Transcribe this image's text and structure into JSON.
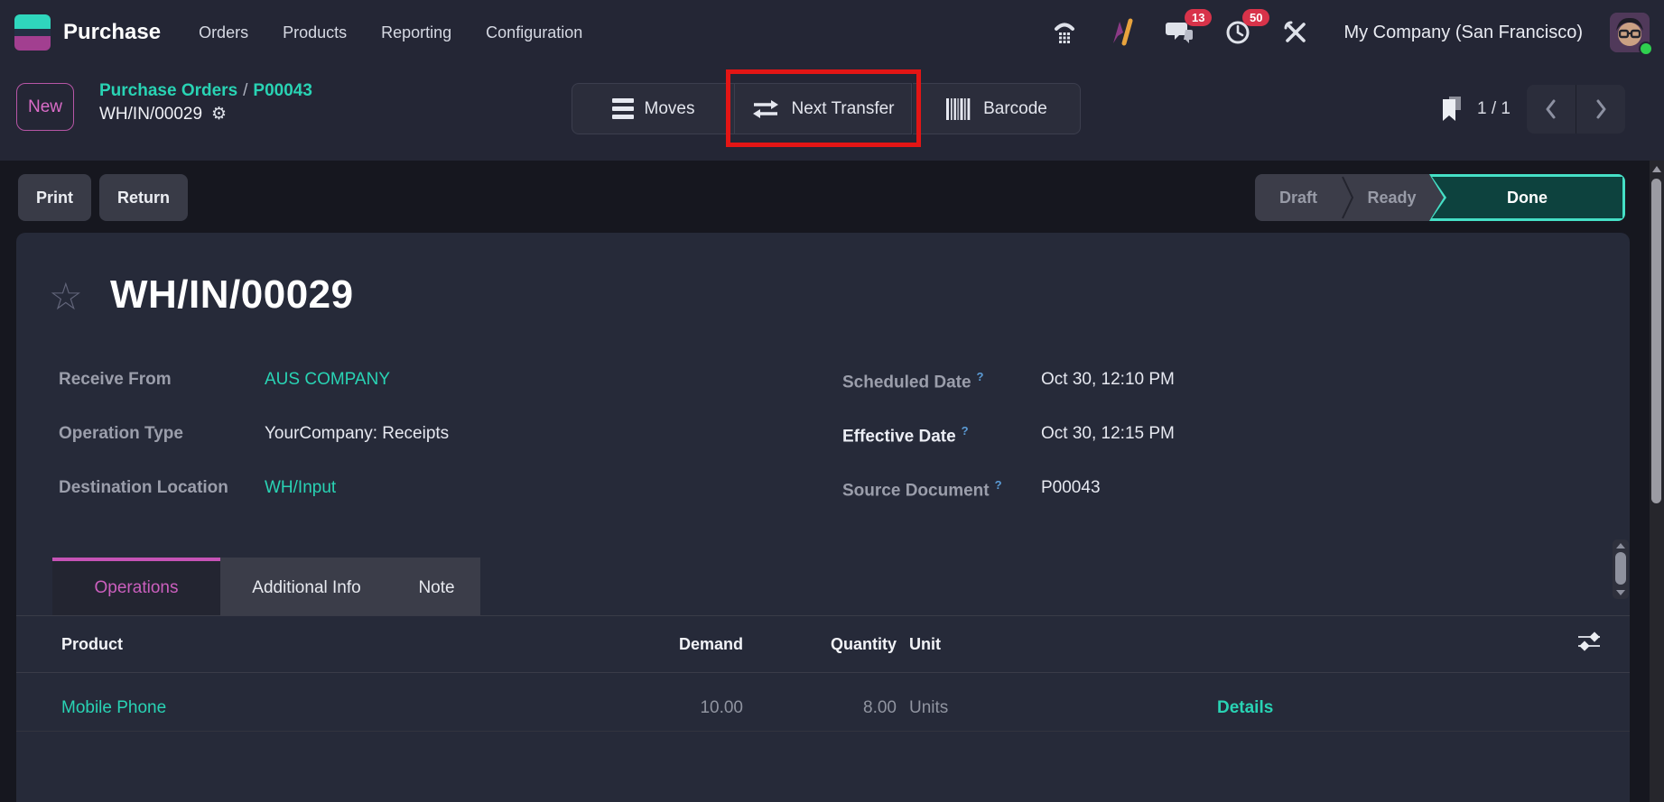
{
  "colors": {
    "accent_teal": "#29d3b4",
    "accent_pink": "#c653b6",
    "badge_red": "#d8334a",
    "annotation_red": "#e31515",
    "done_fill": "#0d423e",
    "done_border": "#45e0c6"
  },
  "nav": {
    "app_name": "Purchase",
    "menus": [
      "Orders",
      "Products",
      "Reporting",
      "Configuration"
    ],
    "message_badge": "13",
    "activity_badge": "50",
    "company": "My Company (San Francisco)"
  },
  "breadcrumb": {
    "new_label": "New",
    "parent": "Purchase Orders",
    "separator": "/",
    "related_doc": "P00043",
    "current": "WH/IN/00029"
  },
  "actions": {
    "moves": "Moves",
    "next_transfer": "Next Transfer",
    "barcode": "Barcode"
  },
  "pager": {
    "counter": "1 / 1"
  },
  "control_panel": {
    "print_label": "Print",
    "return_label": "Return",
    "statuses": [
      {
        "label": "Draft",
        "active": false
      },
      {
        "label": "Ready",
        "active": false
      },
      {
        "label": "Done",
        "active": true
      }
    ]
  },
  "form": {
    "title": "WH/IN/00029",
    "fields_left": [
      {
        "label": "Receive From",
        "value": "AUS COMPANY"
      },
      {
        "label": "Operation Type",
        "value": "YourCompany: Receipts"
      },
      {
        "label": "Destination Location",
        "value": "WH/Input"
      }
    ],
    "fields_right": [
      {
        "label": "Scheduled Date",
        "value": "Oct 30, 12:10 PM",
        "help": "?"
      },
      {
        "label": "Effective Date",
        "value": "Oct 30, 12:15 PM",
        "help": "?"
      },
      {
        "label": "Source Document",
        "value": "P00043",
        "help": "?"
      }
    ]
  },
  "tabs": [
    {
      "label": "Operations",
      "active": true
    },
    {
      "label": "Additional Info",
      "active": false
    },
    {
      "label": "Note",
      "active": false
    }
  ],
  "operations_table": {
    "headers": [
      "Product",
      "Demand",
      "Quantity",
      "Unit"
    ],
    "rows": [
      {
        "product": "Mobile Phone",
        "demand": "10.00",
        "quantity": "8.00",
        "unit": "Units",
        "action": "Details"
      }
    ]
  },
  "icons": {
    "gear": "⚙",
    "star": "☆"
  }
}
